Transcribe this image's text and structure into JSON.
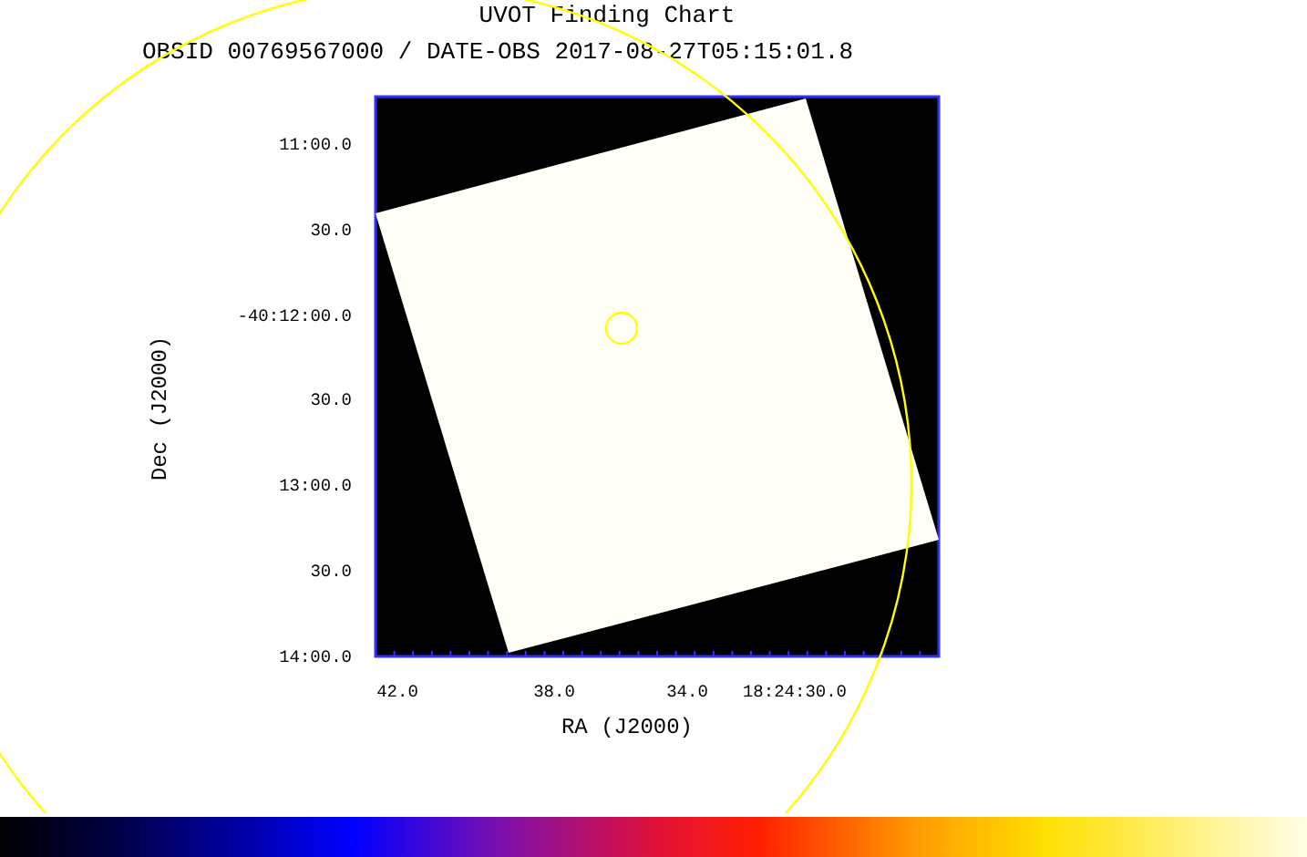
{
  "title": "UVOT Finding Chart",
  "subtitle": "OBSID 00769567000 / DATE-OBS 2017-08-27T05:15:01.8",
  "y_axis": {
    "label": "Dec (J2000)",
    "ticks": [
      "11:00.0",
      "30.0",
      "-40:12:00.0",
      "30.0",
      "13:00.0",
      "30.0",
      "14:00.0"
    ]
  },
  "x_axis": {
    "label": "RA (J2000)",
    "ticks": [
      "42.0",
      "38.0",
      "34.0",
      "18:24:30.0"
    ]
  }
}
